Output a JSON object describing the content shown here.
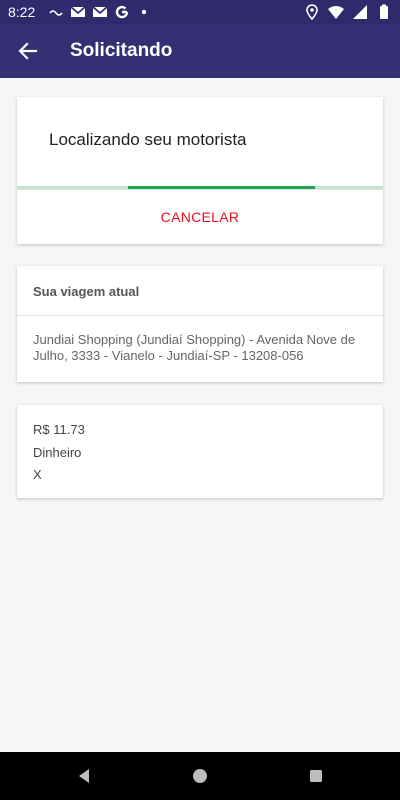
{
  "status_bar": {
    "time": "8:22",
    "left_icons": [
      "ellipsis-icon",
      "gmail-icon",
      "gmail-icon",
      "google-icon",
      "dot-icon"
    ],
    "right_icons": [
      "location-icon",
      "wifi-icon",
      "signal-icon",
      "battery-icon"
    ]
  },
  "app_bar": {
    "title": "Solicitando",
    "color": "#342f73"
  },
  "search_card": {
    "text": "Localizando seu motorista",
    "cancel_label": "CANCELAR",
    "cancel_color": "#e8101e",
    "progress_color": "#1ea54e"
  },
  "trip_card": {
    "header": "Sua viagem atual",
    "address": "Jundiai Shopping (Jundiaí Shopping) - Avenida Nove de Julho, 3333 - Vianelo - Jundiaí-SP - 13208-056"
  },
  "payment_card": {
    "price": "R$ 11.73",
    "method": "Dinheiro",
    "extra": "X"
  },
  "nav_bar": {
    "buttons": [
      "back-triangle-icon",
      "home-circle-icon",
      "recents-square-icon"
    ]
  }
}
